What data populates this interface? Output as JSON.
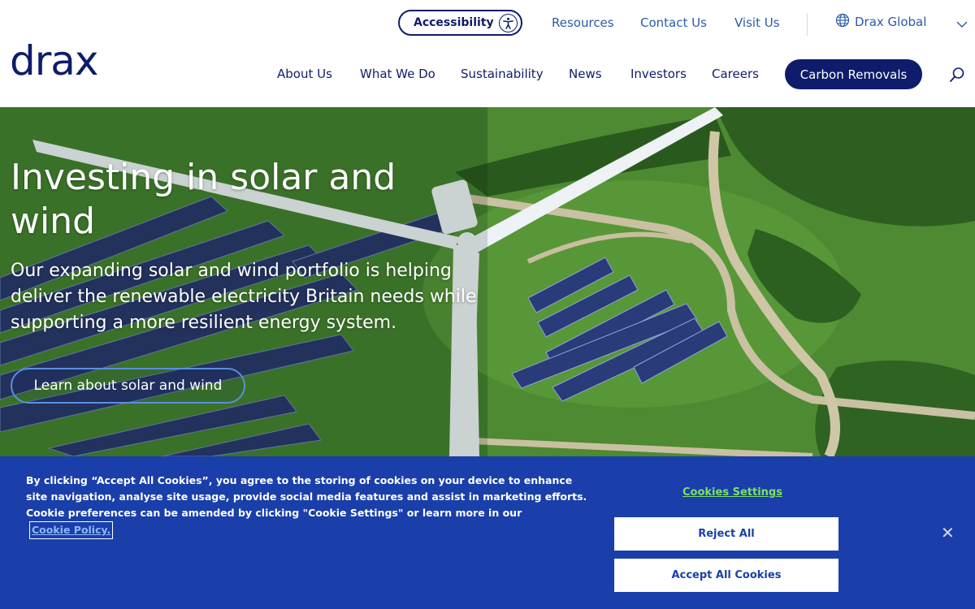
{
  "header": {
    "logo": "drax",
    "accessibility_label": "Accessibility",
    "util_links": [
      "Resources",
      "Contact Us",
      "Visit Us"
    ],
    "global_label": "Drax Global",
    "nav": [
      "About Us",
      "What We Do",
      "Sustainability",
      "News",
      "Investors",
      "Careers"
    ],
    "cta_label": "Carbon Removals"
  },
  "hero": {
    "title": "Investing in solar and wind",
    "subtitle": "Our expanding solar and wind portfolio is helping deliver the renewable electricity Britain needs while supporting a more resilient energy system.",
    "button_label": "Learn about solar and wind"
  },
  "cookie": {
    "text": "By clicking “Accept All Cookies”, you agree to the storing of cookies on your device to enhance site navigation, analyse site usage, provide social media features and assist in marketing efforts. Cookie preferences can be amended by clicking \"Cookie Settings\" or learn more in our",
    "policy_link": "Cookie Policy.",
    "settings_label": "Cookies Settings",
    "reject_label": "Reject All",
    "accept_label": "Accept All Cookies",
    "close_glyph": "✕"
  },
  "colors": {
    "brand_navy": "#0f1c6b",
    "link_blue": "#2b5aa8",
    "cookie_bg": "#1a3faa",
    "settings_green": "#7ce06a"
  },
  "icons": [
    "accessibility-icon",
    "globe-icon",
    "chevron-down-icon",
    "search-icon",
    "close-icon"
  ]
}
